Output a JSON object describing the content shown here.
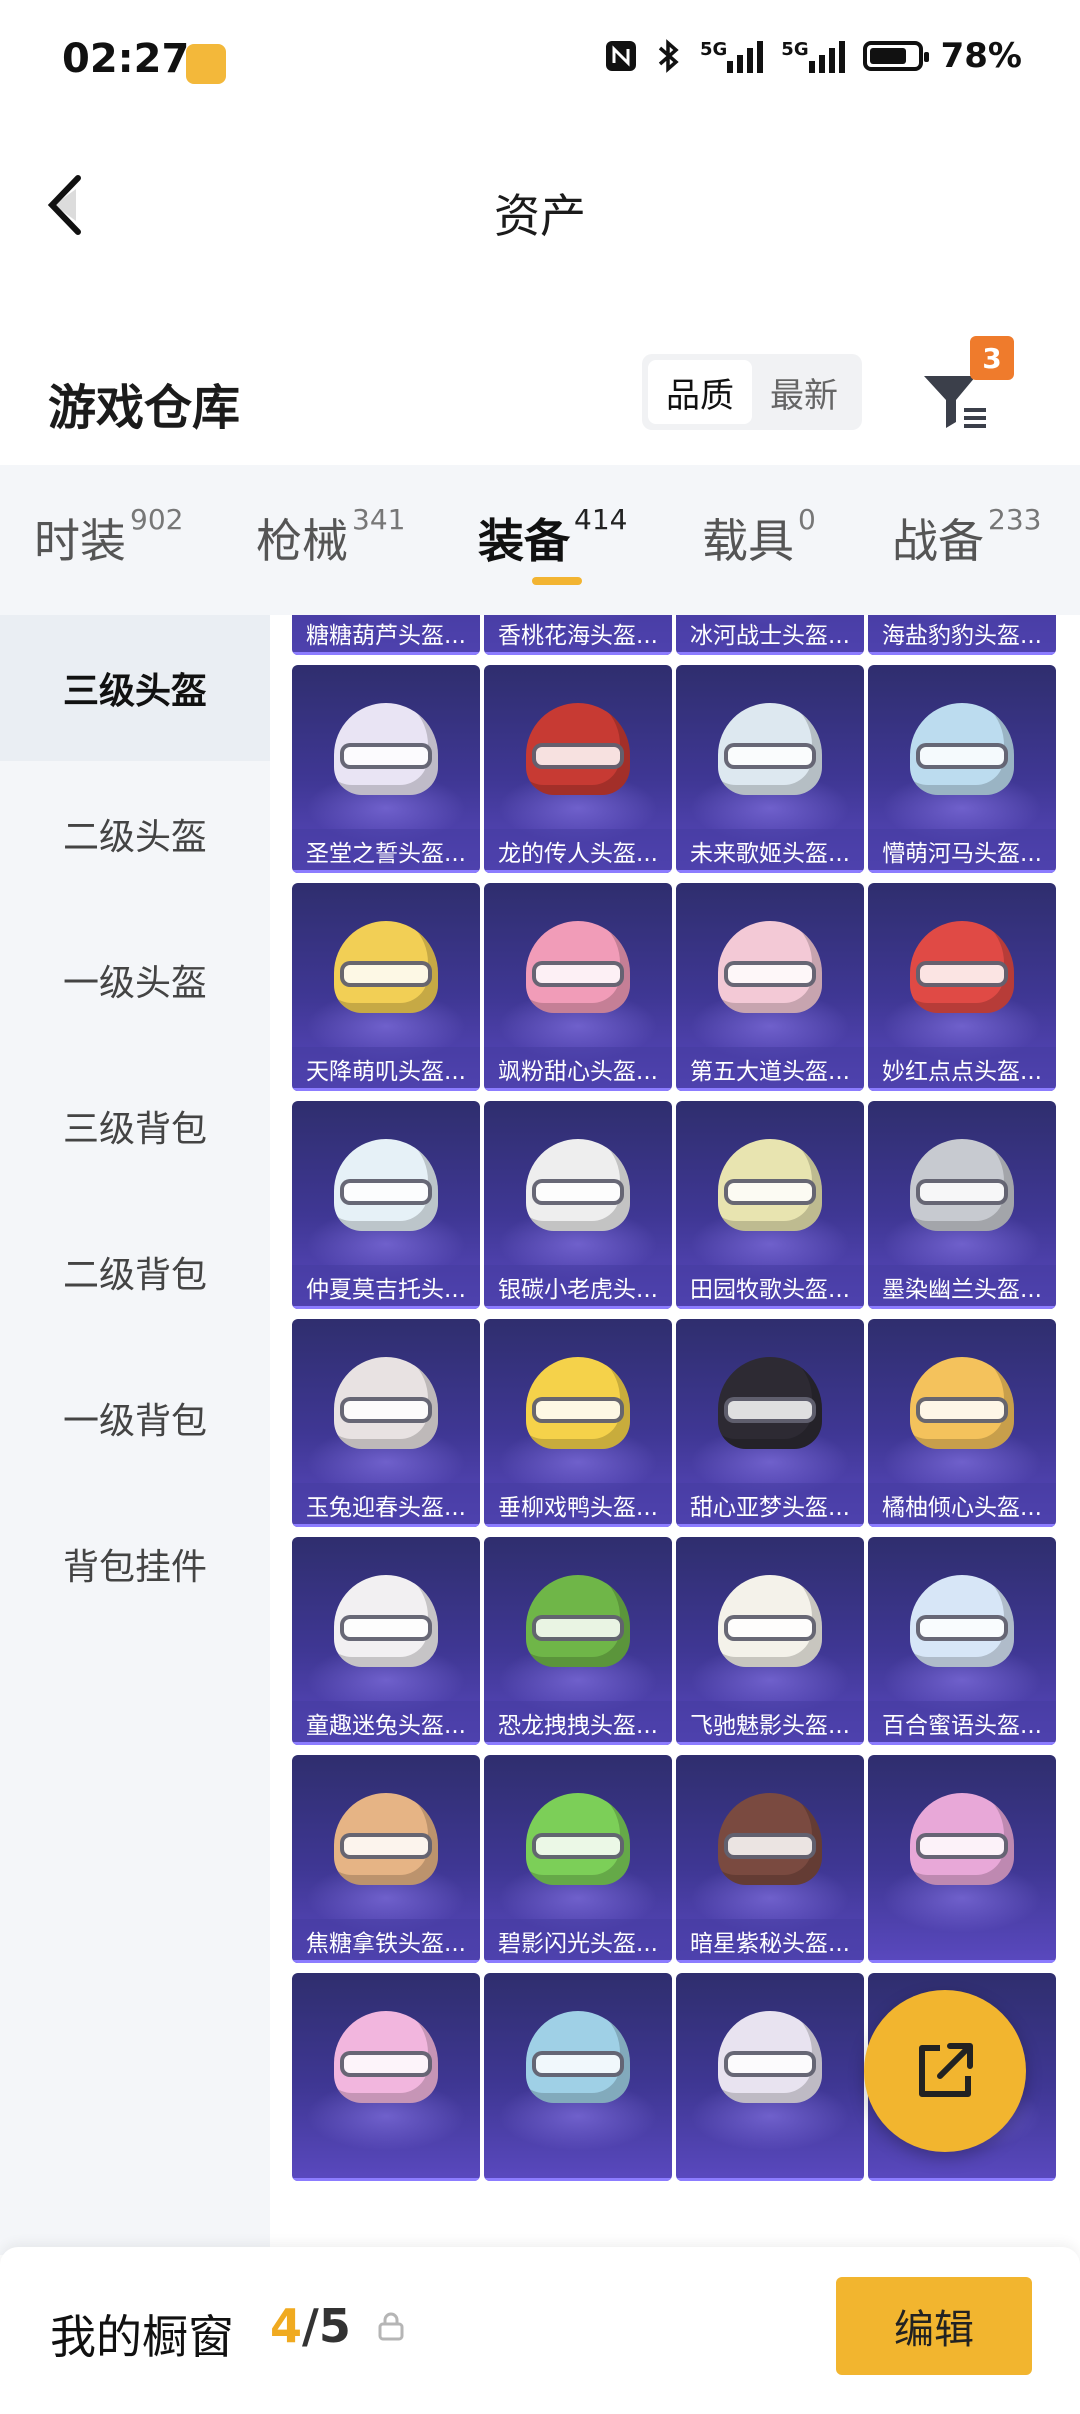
{
  "status_bar": {
    "time": "02:27",
    "network1": "5G",
    "network2": "5G",
    "battery_percent_text": "78%",
    "battery_level": 0.78,
    "icons": [
      "nfc-icon",
      "bluetooth-icon",
      "signal-icon",
      "signal-icon",
      "battery-icon"
    ]
  },
  "header": {
    "title": "资产",
    "back_icon": "chevron-left-icon"
  },
  "section": {
    "title": "游戏仓库",
    "sort_options": [
      "品质",
      "最新"
    ],
    "sort_selected": "品质",
    "filter_icon": "filter-funnel-icon",
    "filter_badge": "3"
  },
  "tabs": [
    {
      "label": "时装",
      "count": "902"
    },
    {
      "label": "枪械",
      "count": "341"
    },
    {
      "label": "装备",
      "count": "414"
    },
    {
      "label": "载具",
      "count": "0"
    },
    {
      "label": "战备",
      "count": "233"
    }
  ],
  "active_tab": "装备",
  "sidebar": {
    "items": [
      "三级头盔",
      "二级头盔",
      "一级头盔",
      "三级背包",
      "二级背包",
      "一级背包",
      "背包挂件"
    ],
    "selected": "三级头盔"
  },
  "items": [
    {
      "name": "糖糖葫芦头盔...",
      "color": "#e0563a"
    },
    {
      "name": "香桃花海头盔...",
      "color": "#f4a8c4"
    },
    {
      "name": "冰河战士头盔...",
      "color": "#dfe6f5"
    },
    {
      "name": "海盐豹豹头盔...",
      "color": "#cfe4f6"
    },
    {
      "name": "圣堂之誓头盔...",
      "color": "#e9e4f4"
    },
    {
      "name": "龙的传人头盔...",
      "color": "#c73a33"
    },
    {
      "name": "未来歌姬头盔...",
      "color": "#dde8f0"
    },
    {
      "name": "懵萌河马头盔...",
      "color": "#bcdcef"
    },
    {
      "name": "天降萌叽头盔...",
      "color": "#f2cf55"
    },
    {
      "name": "飒粉甜心头盔...",
      "color": "#f19cb8"
    },
    {
      "name": "第五大道头盔...",
      "color": "#f3c9d6"
    },
    {
      "name": "妙红点点头盔...",
      "color": "#e04a45"
    },
    {
      "name": "仲夏莫吉托头...",
      "color": "#e6f1f7"
    },
    {
      "name": "银碳小老虎头...",
      "color": "#eeeeee"
    },
    {
      "name": "田园牧歌头盔...",
      "color": "#e8e4b0"
    },
    {
      "name": "墨染幽兰头盔...",
      "color": "#c7cad0"
    },
    {
      "name": "玉兔迎春头盔...",
      "color": "#e8e2e2"
    },
    {
      "name": "垂柳戏鸭头盔...",
      "color": "#f5d24a"
    },
    {
      "name": "甜心亚梦头盔...",
      "color": "#2d2a33"
    },
    {
      "name": "橘柚倾心头盔...",
      "color": "#f4c25c"
    },
    {
      "name": "童趣迷兔头盔...",
      "color": "#f2f0f2"
    },
    {
      "name": "恐龙拽拽头盔...",
      "color": "#6fb648"
    },
    {
      "name": "飞驰魅影头盔...",
      "color": "#f4f2ea"
    },
    {
      "name": "百合蜜语头盔...",
      "color": "#d7e6f7"
    },
    {
      "name": "焦糖拿铁头盔...",
      "color": "#e6b485"
    },
    {
      "name": "碧影闪光头盔...",
      "color": "#7ccf58"
    },
    {
      "name": "暗星紫秘头盔...",
      "color": "#7a4a40"
    },
    {
      "name": "",
      "color": "#e8a8d8"
    },
    {
      "name": "",
      "color": "#f2b6de"
    },
    {
      "name": "",
      "color": "#9fd0e6"
    },
    {
      "name": "",
      "color": "#e8e3f0"
    },
    {
      "name": "",
      "color": "#bfd8f2"
    }
  ],
  "share_button_icon": "share-export-icon",
  "bottom_bar": {
    "label": "我的橱窗",
    "count_current": "4",
    "count_separator": "/",
    "count_total": "5",
    "lock_icon": "lock-icon",
    "edit_label": "编辑"
  }
}
